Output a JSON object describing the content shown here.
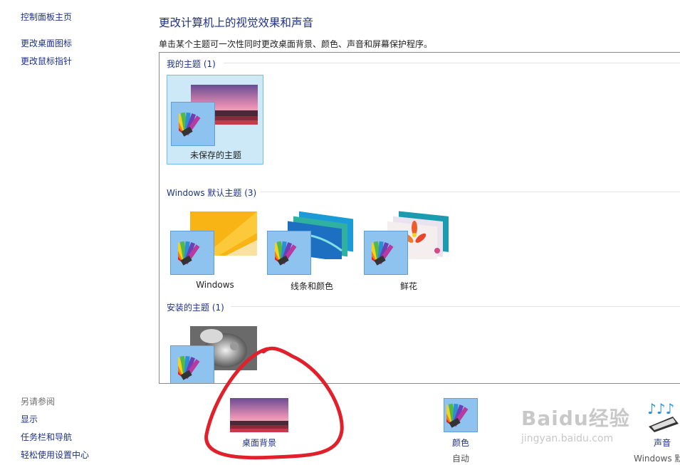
{
  "left_nav": {
    "home": "控制面板主页",
    "desktop_icons": "更改桌面图标",
    "mouse_pointers": "更改鼠标指针",
    "see_also_title": "另请参阅",
    "display": "显示",
    "taskbar": "任务栏和导航",
    "ease_of_access": "轻松使用设置中心"
  },
  "header": {
    "title": "更改计算机上的视觉效果和声音",
    "description": "单击某个主题可一次性同时更改桌面背景、颜色、声音和屏幕保护程序。"
  },
  "groups": {
    "my_themes": {
      "label": "我的主题 (1)"
    },
    "default_themes": {
      "label": "Windows 默认主题 (3)"
    },
    "installed_themes": {
      "label": "安装的主题 (1)"
    }
  },
  "themes": {
    "unsaved": "未保存的主题",
    "windows": "Windows",
    "lines_colors": "线条和颜色",
    "flowers": "鲜花"
  },
  "bottom": {
    "desktop_background": "桌面背景",
    "color": "颜色",
    "color_value": "自动",
    "sound": "声音",
    "sound_value": "Windows 默"
  },
  "watermark": {
    "brand": "Baidu经验",
    "url": "jingyan.baidu.com"
  },
  "colors": {
    "link": "#1e3287",
    "selected_bg": "#cde8f7",
    "annotation": "#e0202a"
  }
}
